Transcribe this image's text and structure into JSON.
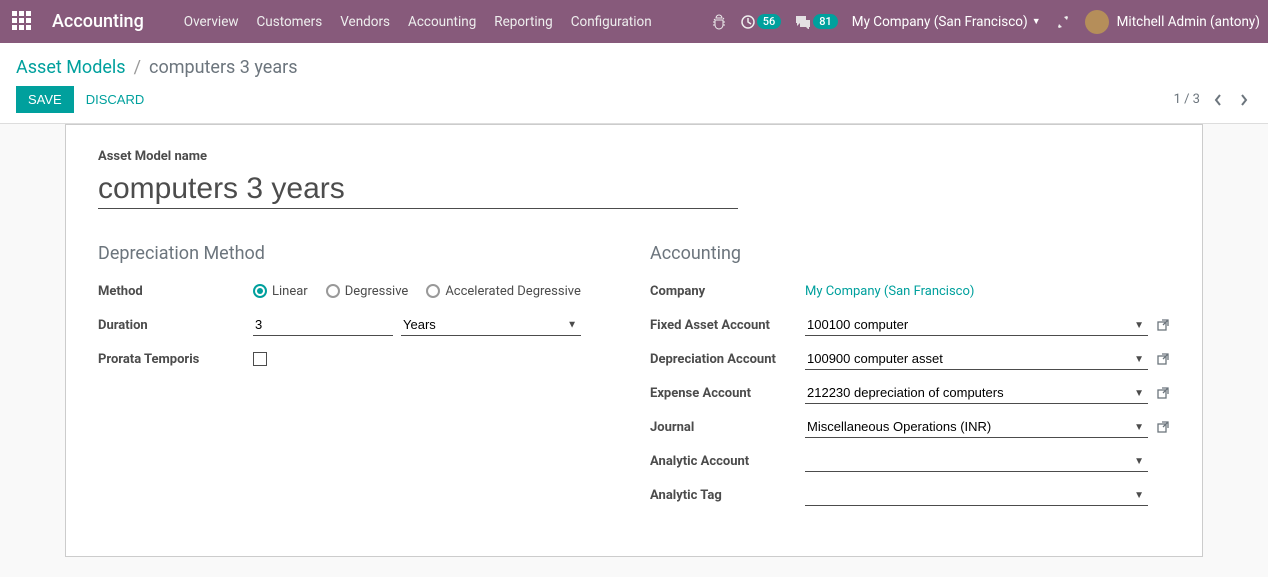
{
  "navbar": {
    "brand": "Accounting",
    "menu": [
      "Overview",
      "Customers",
      "Vendors",
      "Accounting",
      "Reporting",
      "Configuration"
    ],
    "clock_badge": "56",
    "chat_badge": "81",
    "company": "My Company (San Francisco)",
    "user": "Mitchell Admin (antony)"
  },
  "breadcrumb": {
    "parent": "Asset Models",
    "current": "computers 3 years"
  },
  "buttons": {
    "save": "SAVE",
    "discard": "DISCARD"
  },
  "pager": {
    "text": "1 / 3"
  },
  "form": {
    "title_label": "Asset Model name",
    "title_value": "computers 3 years",
    "section_dep": "Depreciation Method",
    "section_acc": "Accounting",
    "labels": {
      "method": "Method",
      "duration": "Duration",
      "prorata": "Prorata Temporis",
      "company": "Company",
      "fixed": "Fixed Asset Account",
      "depr": "Depreciation Account",
      "expense": "Expense Account",
      "journal": "Journal",
      "analytic_acc": "Analytic Account",
      "analytic_tag": "Analytic Tag"
    },
    "method_options": {
      "linear": "Linear",
      "degressive": "Degressive",
      "accel": "Accelerated Degressive"
    },
    "duration_value": "3",
    "duration_unit": "Years",
    "company_value": "My Company (San Francisco)",
    "fixed_value": "100100 computer",
    "depr_value": "100900 computer asset",
    "expense_value": "212230 depreciation of computers",
    "journal_value": "Miscellaneous Operations (INR)",
    "analytic_acc_value": "",
    "analytic_tag_value": ""
  }
}
